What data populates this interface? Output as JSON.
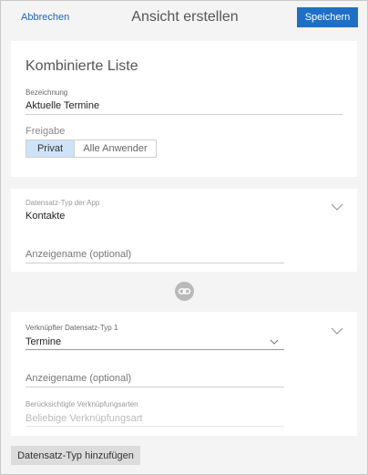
{
  "header": {
    "cancel_label": "Abbrechen",
    "title": "Ansicht erstellen",
    "save_label": "Speichern"
  },
  "list_section": {
    "heading": "Kombinierte Liste",
    "name_label": "Bezeichnung",
    "name_value": "Aktuelle Termine",
    "share_label": "Freigabe",
    "share_options": [
      "Privat",
      "Alle Anwender"
    ],
    "share_selected": "Privat"
  },
  "app_record": {
    "type_label": "Datensatz-Typ der App",
    "type_value": "Kontakte",
    "display_name_placeholder": "Anzeigename (optional)"
  },
  "linked_record": {
    "type_label": "Verknüpfter Datensatz-Typ 1",
    "type_value": "Termine",
    "display_name_placeholder": "Anzeigename (optional)",
    "link_kinds_label": "Berücksichtigte Verknüpfungsarten",
    "link_kinds_value": "Beliebige Verknüpfungsart"
  },
  "footer": {
    "add_button_label": "Datensatz-Typ hinzufügen"
  },
  "icons": {
    "link": "link-icon",
    "chevron": "chevron-down-icon"
  },
  "colors": {
    "accent": "#1f6fc5",
    "link_text": "#2266b8",
    "selected_segment": "#cfe3f8"
  }
}
